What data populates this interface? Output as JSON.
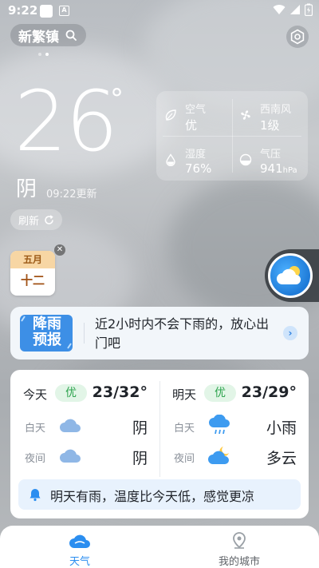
{
  "status_bar": {
    "time": "9:22",
    "battery_icon": "battery-charging-icon"
  },
  "header": {
    "location": "新繁镇"
  },
  "current": {
    "temperature": "26",
    "degree_symbol": "°",
    "condition": "阴",
    "updated": "09:22更新",
    "refresh_label": "刷新"
  },
  "metrics": {
    "air": {
      "label": "空气",
      "value": "优",
      "icon": "leaf-icon"
    },
    "wind": {
      "label": "西南风",
      "value": "1级",
      "icon": "fan-icon"
    },
    "humidity": {
      "label": "湿度",
      "value": "76%",
      "icon": "droplet-icon"
    },
    "pressure": {
      "label": "气压",
      "value": "941",
      "unit": "hPa",
      "icon": "gauge-icon"
    }
  },
  "calendar": {
    "month": "五月",
    "day": "十二"
  },
  "rain_banner": {
    "badge_line1": "降雨",
    "badge_line2": "预报",
    "text": "近2小时内不会下雨的，放心出门吧"
  },
  "forecast": {
    "today": {
      "label": "今天",
      "aqi": "优",
      "range": "23/32°",
      "day_label": "白天",
      "day_cond": "阴",
      "day_icon": "cloud-icon",
      "night_label": "夜间",
      "night_cond": "阴",
      "night_icon": "cloud-icon"
    },
    "tomorrow": {
      "label": "明天",
      "aqi": "优",
      "range": "23/29°",
      "day_label": "白天",
      "day_cond": "小雨",
      "day_icon": "rain-cloud-icon",
      "night_label": "夜间",
      "night_cond": "多云",
      "night_icon": "moon-cloud-icon"
    },
    "tip": "明天有雨，温度比今天低，感觉更凉"
  },
  "nav": {
    "tabs": [
      {
        "label": "天气",
        "active": true
      },
      {
        "label": "我的城市",
        "active": false
      }
    ]
  },
  "colors": {
    "accent": "#2b8ef0",
    "aqi_good": "#2da44e"
  }
}
